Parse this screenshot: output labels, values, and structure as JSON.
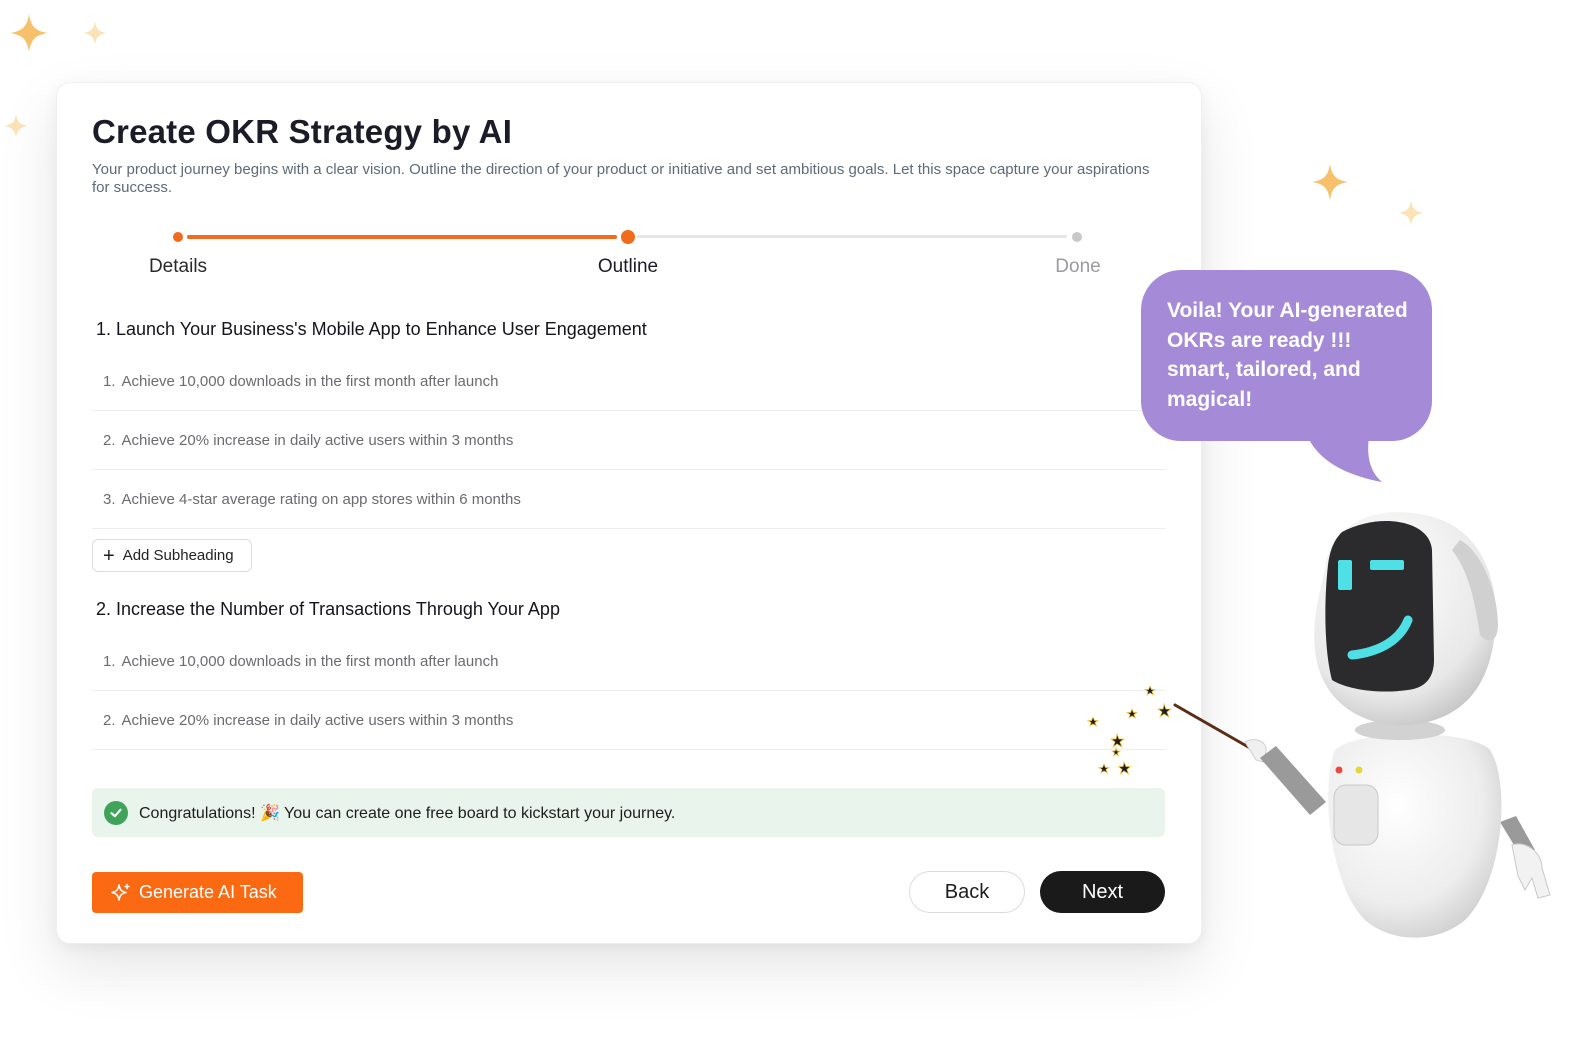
{
  "header": {
    "title": "Create OKR Strategy by AI",
    "subtitle": "Your product journey begins with a clear vision. Outline the direction of your product or initiative and set ambitious goals. Let this space capture your aspirations for success."
  },
  "stepper": {
    "steps": [
      {
        "label": "Details",
        "state": "complete"
      },
      {
        "label": "Outline",
        "state": "current"
      },
      {
        "label": "Done",
        "state": "pending"
      }
    ],
    "active_color": "#F26B1D",
    "inactive_color": "#E6E6E6"
  },
  "sections": [
    {
      "title": "1. Launch Your Business's Mobile App to Enhance User Engagement",
      "items": [
        {
          "num": "1.",
          "text": "Achieve 10,000 downloads in the first month after launch"
        },
        {
          "num": "2.",
          "text": "Achieve 20% increase in daily active users within 3 months"
        },
        {
          "num": "3.",
          "text": "Achieve 4-star average rating on app stores within 6 months"
        }
      ]
    },
    {
      "title": "2. Increase the Number of Transactions Through Your App",
      "items": [
        {
          "num": "1.",
          "text": "Achieve 10,000 downloads in the first month after launch"
        },
        {
          "num": "2.",
          "text": "Achieve 20% increase in daily active users within 3 months"
        }
      ]
    }
  ],
  "add_subheading_label": "Add Subheading",
  "banner": {
    "text": "Congratulations! 🎉 You can create one free board to kickstart your journey."
  },
  "footer": {
    "generate_label": "Generate AI Task",
    "back_label": "Back",
    "next_label": "Next"
  },
  "mascot": {
    "speech": "Voila! Your AI-generated OKRs are ready !!! smart, tailored, and magical!"
  },
  "colors": {
    "accent": "#FB6A12",
    "success": "#3FA45A",
    "banner_bg": "#E9F5EC",
    "bubble": "#A58AD8"
  }
}
